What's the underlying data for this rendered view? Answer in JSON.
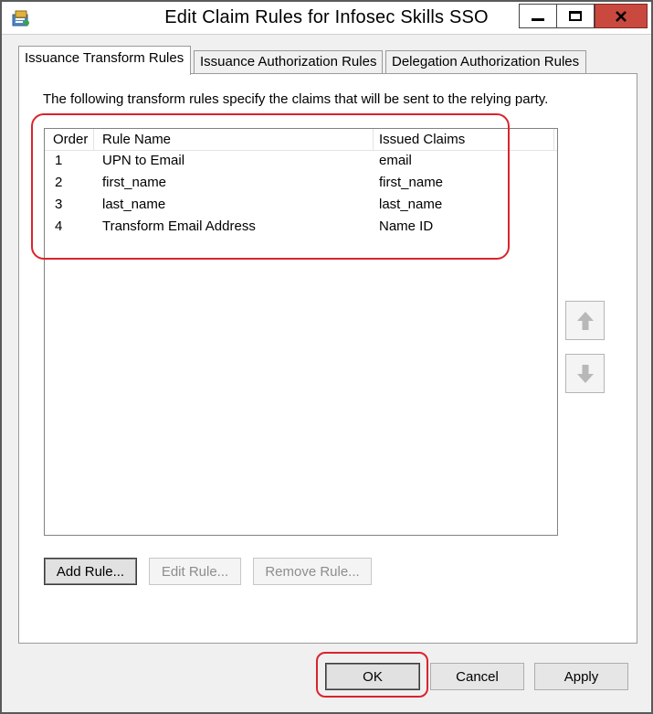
{
  "window": {
    "title": "Edit Claim Rules for Infosec Skills SSO",
    "icon": "claims-app-icon",
    "controls": {
      "minimize": "minimize-icon",
      "maximize": "maximize-icon",
      "close": "close-icon"
    }
  },
  "tabs": [
    {
      "label": "Issuance Transform Rules",
      "active": true
    },
    {
      "label": "Issuance Authorization Rules",
      "active": false
    },
    {
      "label": "Delegation Authorization Rules",
      "active": false
    }
  ],
  "panel": {
    "description": "The following transform rules specify the claims that will be sent to the relying party."
  },
  "rules_table": {
    "columns": [
      "Order",
      "Rule Name",
      "Issued Claims"
    ],
    "rows": [
      {
        "order": "1",
        "name": "UPN to Email",
        "claims": "email"
      },
      {
        "order": "2",
        "name": "first_name",
        "claims": "first_name"
      },
      {
        "order": "3",
        "name": "last_name",
        "claims": "last_name"
      },
      {
        "order": "4",
        "name": "Transform Email Address",
        "claims": "Name ID"
      }
    ]
  },
  "move_buttons": {
    "up": "arrow-up-icon",
    "down": "arrow-down-icon"
  },
  "rule_buttons": {
    "add": "Add Rule...",
    "edit": "Edit Rule...",
    "remove": "Remove Rule..."
  },
  "dialog_buttons": {
    "ok": "OK",
    "cancel": "Cancel",
    "apply": "Apply"
  },
  "colors": {
    "highlight": "#d9242c",
    "close_button": "#c9493f",
    "dialog_background": "#f0f0f0"
  }
}
